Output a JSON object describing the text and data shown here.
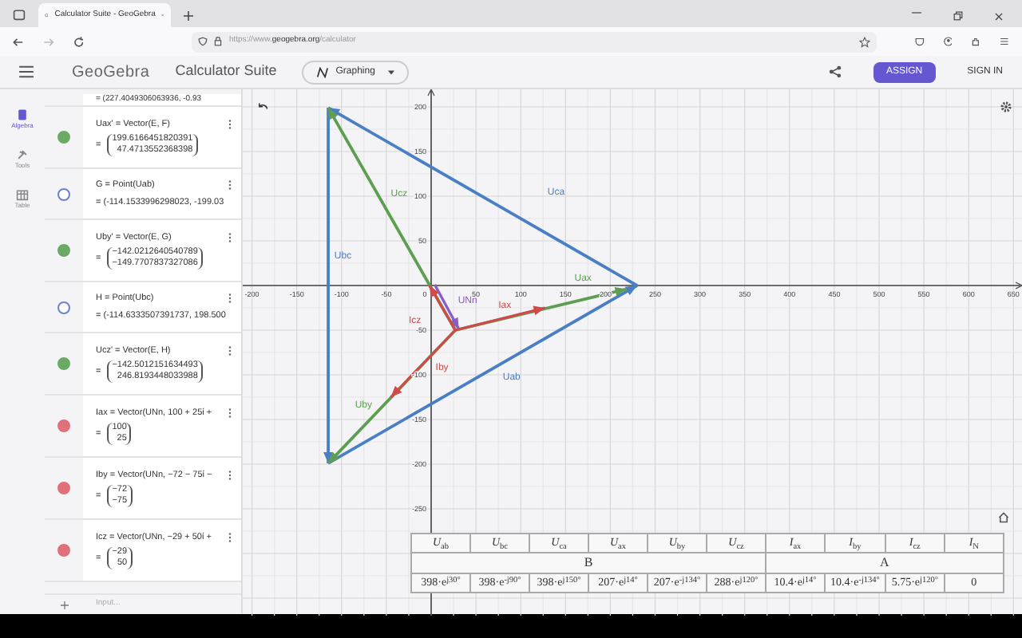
{
  "browser": {
    "tab_title": "Calculator Suite - GeoGebra",
    "url_host": "https://www.geogebra.org",
    "url_path": "/calculator"
  },
  "header": {
    "logo": "GeoGebra",
    "title": "Calculator Suite",
    "app_menu": "Graphing",
    "assign": "ASSIGN",
    "sign_in": "SIGN IN"
  },
  "sidebar": {
    "items": [
      {
        "label": "Algebra",
        "kind": "algebra",
        "selected": true
      },
      {
        "label": "Tools",
        "kind": "tools",
        "selected": false
      },
      {
        "label": "Table",
        "kind": "table",
        "selected": false
      }
    ]
  },
  "algebra": {
    "items": [
      {
        "kind": "partial",
        "value": "= (227.4049306063936, -0.93"
      },
      {
        "kind": "vector",
        "definition": "Uax' = Vector(E, F)",
        "equals": "=",
        "values": [
          "199.6166451820391",
          "47.4713552368398"
        ],
        "visible": true,
        "color": "#6aaa64"
      },
      {
        "kind": "point",
        "definition": "G = Point(Uab)",
        "value": "= (-114.1533996298023, -199.03",
        "visible": false,
        "color": "#6c7fd0"
      },
      {
        "kind": "vector",
        "definition": "Uby' = Vector(E, G)",
        "equals": "=",
        "values": [
          "−142.0212640540789",
          "−149.7707837327086"
        ],
        "visible": true,
        "color": "#6aaa64"
      },
      {
        "kind": "point",
        "definition": "H = Point(Ubc)",
        "value": "= (-114.6333507391737, 198.500",
        "visible": false,
        "color": "#6c7fd0"
      },
      {
        "kind": "vector",
        "definition": "Ucz' = Vector(E, H)",
        "equals": "=",
        "values": [
          "−142.5012151634493",
          "246.8193448033988"
        ],
        "visible": true,
        "color": "#6aaa64"
      },
      {
        "kind": "vector",
        "definition": "Iax = Vector(UNn, 100 + 25ί +",
        "equals": "=",
        "values": [
          "100",
          "25"
        ],
        "visible": true,
        "color": "#e0707a"
      },
      {
        "kind": "vector",
        "definition": "Iby = Vector(UNn, −72 − 75ί −",
        "equals": "=",
        "values": [
          "−72",
          "−75"
        ],
        "visible": true,
        "color": "#e0707a"
      },
      {
        "kind": "vector",
        "definition": "Icz = Vector(UNn, −29 + 50ί +",
        "equals": "=",
        "values": [
          "−29",
          "50"
        ],
        "visible": true,
        "color": "#e0707a"
      }
    ],
    "input_placeholder": "Input..."
  },
  "graph": {
    "x_labels": [
      "-200",
      "-150",
      "-100",
      "-50",
      "0",
      "50",
      "100",
      "150",
      "200",
      "250",
      "300",
      "350",
      "400",
      "450",
      "500",
      "550",
      "600",
      "650"
    ],
    "y_labels": [
      "200",
      "150",
      "100",
      "50",
      "-50",
      "-100",
      "-150",
      "-200",
      "-250"
    ],
    "vectors": [
      {
        "label": "Uca",
        "color": "#4a7fc4"
      },
      {
        "label": "Ubc",
        "color": "#4a7fc4"
      },
      {
        "label": "Uab",
        "color": "#4a7fc4"
      },
      {
        "label": "Ucz",
        "color": "#5e9e52"
      },
      {
        "label": "Uby",
        "color": "#5e9e52"
      },
      {
        "label": "Uax",
        "color": "#5e9e52"
      },
      {
        "label": "UNn",
        "color": "#8a5cc8"
      },
      {
        "label": "Iax",
        "color": "#d04a4a"
      },
      {
        "label": "Iby",
        "color": "#d04a4a"
      },
      {
        "label": "Icz",
        "color": "#d04a4a"
      }
    ]
  },
  "table": {
    "headers": [
      "*U*$_{ab}$",
      "*U*$_{bc}$",
      "*U*$_{ca}$",
      "*U*$_{ax}$",
      "*U*$_{by}$",
      "*U*$_{cz}$",
      "*I*$_{ax}$",
      "*I*$_{by}$",
      "*I*$_{cz}$",
      "*I*$_{N}$"
    ],
    "groups": [
      "B",
      "A"
    ],
    "values": [
      "398·e$^{j30°}$",
      "398·e$^{-j90°}$",
      "398·e$^{j150°}$",
      "207·e$^{j14°}$",
      "207·e$^{-j134°}$",
      "288·e$^{j120°}$",
      "10.4·e$^{j14°}$",
      "10.4·e$^{-j134°}$",
      "5.75·e$^{j120°}$",
      "0"
    ]
  }
}
